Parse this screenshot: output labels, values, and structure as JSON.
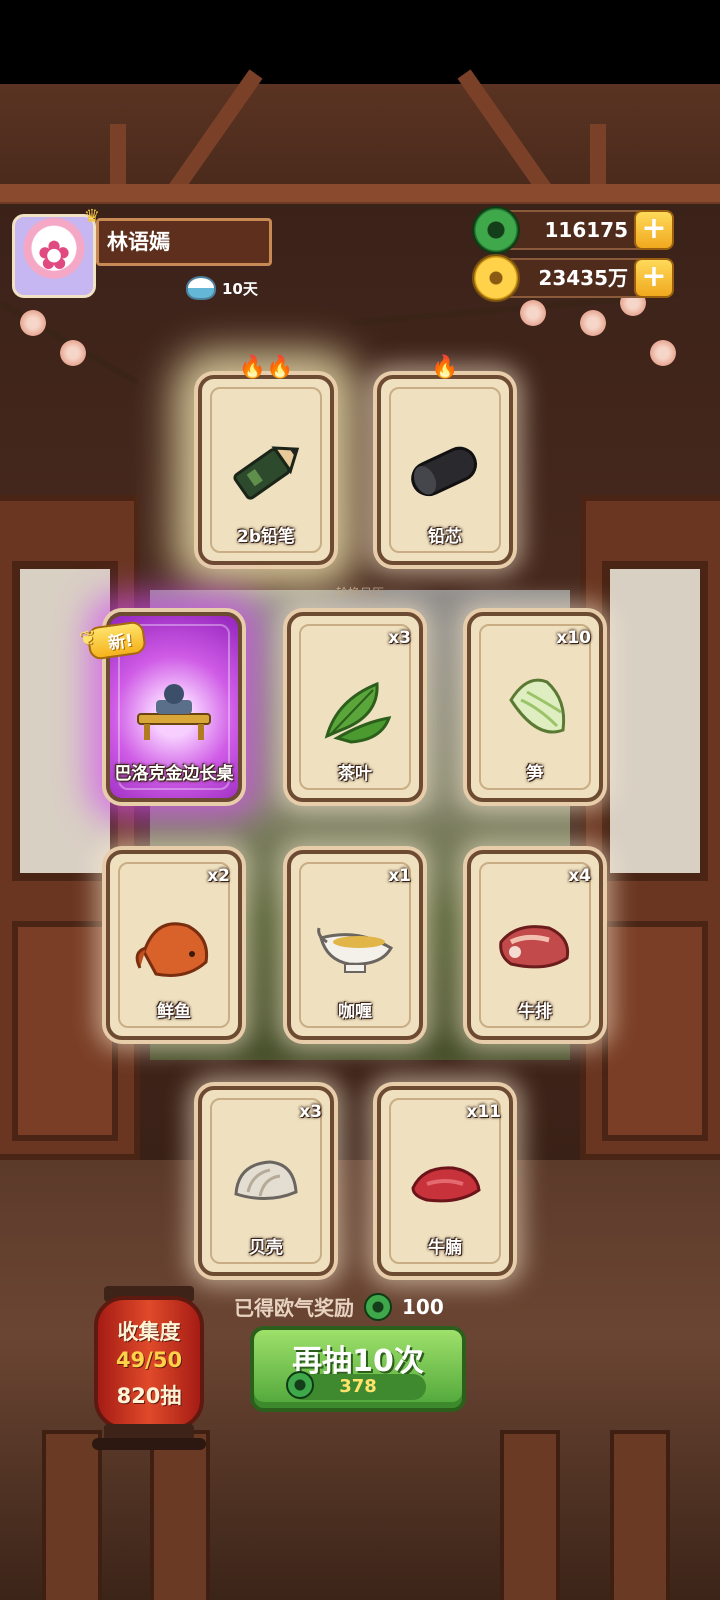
{
  "player": {
    "name": "林语嫣",
    "days": "10天"
  },
  "currency": {
    "jade": "116175",
    "coins": "23435万"
  },
  "scene_label": "轮换日历",
  "cards": [
    {
      "name": "2b铅笔",
      "count": "",
      "flames": "🔥🔥",
      "icon": "pencil-icon"
    },
    {
      "name": "铅芯",
      "count": "",
      "flames": "🔥",
      "icon": "pencil-lead-icon"
    },
    {
      "name": "巴洛克金边长桌",
      "count": "",
      "badge": "新",
      "icon": "baroque-table-icon"
    },
    {
      "name": "茶叶",
      "count": "x3",
      "icon": "tea-leaf-icon"
    },
    {
      "name": "笋",
      "count": "x10",
      "icon": "bamboo-shoot-icon"
    },
    {
      "name": "鲜鱼",
      "count": "x2",
      "icon": "fish-icon"
    },
    {
      "name": "咖喱",
      "count": "x1",
      "icon": "curry-gravy-boat-icon"
    },
    {
      "name": "牛排",
      "count": "x4",
      "icon": "steak-icon"
    },
    {
      "name": "贝壳",
      "count": "x3",
      "icon": "clam-icon"
    },
    {
      "name": "牛腩",
      "count": "x11",
      "icon": "beef-brisket-icon"
    }
  ],
  "reward": {
    "label": "已得欧气奖励",
    "value": "100"
  },
  "redraw": {
    "label": "再抽10次",
    "cost": "378"
  },
  "collection": {
    "title": "收集度",
    "progress": "49/50",
    "draws": "820抽"
  }
}
